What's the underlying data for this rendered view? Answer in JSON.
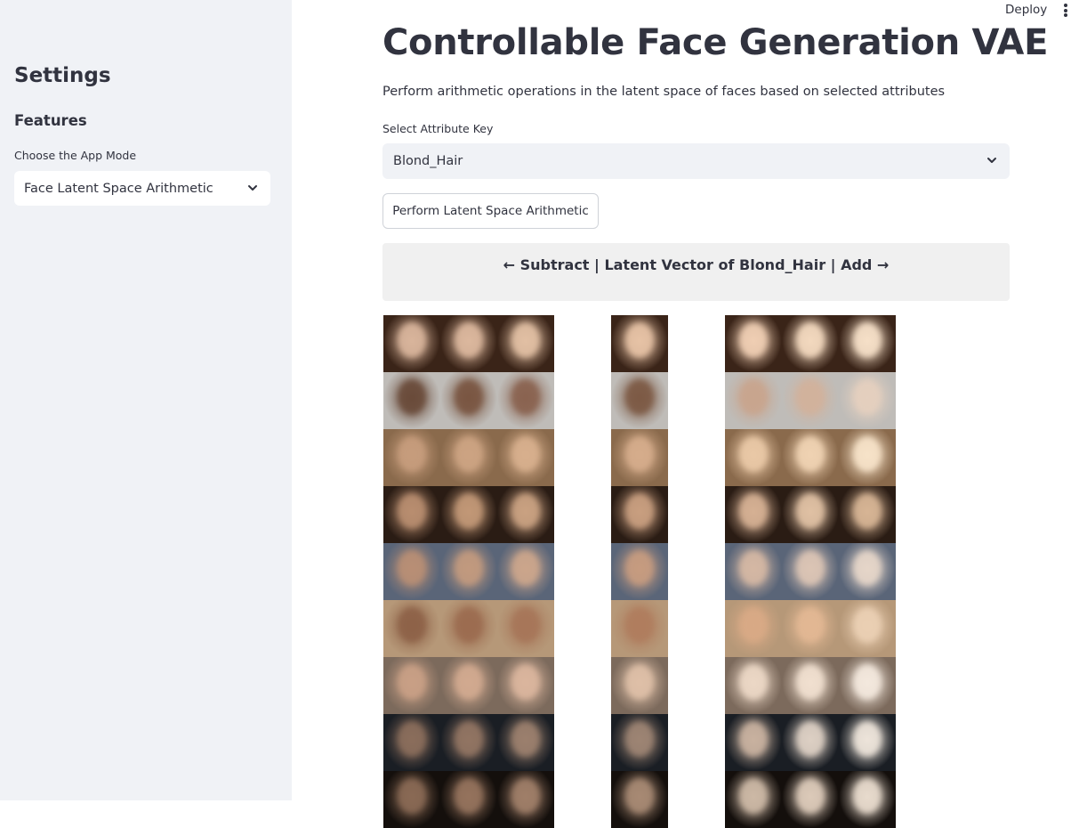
{
  "sidebar": {
    "title": "Settings",
    "subtitle": "Features",
    "mode_label": "Choose the App Mode",
    "mode_value": "Face Latent Space Arithmetic"
  },
  "header": {
    "deploy_label": "Deploy"
  },
  "main": {
    "title": "Controllable Face Generation VAE",
    "description": "Perform arithmetic operations in the latent space of faces based on selected attributes",
    "attribute_label": "Select Attribute Key",
    "attribute_value": "Blond_Hair",
    "button_label": "Perform Latent Space Arithmetic",
    "banner_text": "← Subtract | Latent Vector of Blond_Hair | Add →"
  },
  "face_grids": {
    "rows": [
      {
        "bg": "#3a2418",
        "skin": [
          "#d9b59c",
          "#dcb89e",
          "#e2c0a4",
          "#e7c3a6",
          "#f0cfb4",
          "#f3d9bf",
          "#f6e0c8"
        ]
      },
      {
        "bg": "#bfbcb8",
        "skin": [
          "#6a4b3a",
          "#7a5642",
          "#8a6350",
          "#7d5a45",
          "#c9a58e",
          "#d2b29c",
          "#e5d0bf"
        ]
      },
      {
        "bg": "#8a6a4c",
        "skin": [
          "#c79d7d",
          "#cda483",
          "#d8b08e",
          "#d6ad8c",
          "#eac9a7",
          "#f0d3b3",
          "#f7e3c9"
        ]
      },
      {
        "bg": "#2a1c14",
        "skin": [
          "#b98e70",
          "#c29877",
          "#caa282",
          "#c99f80",
          "#d6b194",
          "#e0c1a4",
          "#d7b595"
        ]
      },
      {
        "bg": "#5a6578",
        "skin": [
          "#b98f75",
          "#c29a7f",
          "#cca68c",
          "#c79c80",
          "#d5b8a4",
          "#dcc5b5",
          "#e6d6c9"
        ]
      },
      {
        "bg": "#b69878",
        "skin": [
          "#8e6248",
          "#9c6c50",
          "#a77659",
          "#b07d5e",
          "#d9aa86",
          "#e3b894",
          "#ebd0b4"
        ]
      },
      {
        "bg": "#7c6a5c",
        "skin": [
          "#c9a086",
          "#d2aa90",
          "#dbb69e",
          "#dfc0a8",
          "#ecd8c6",
          "#f1e0d0",
          "#f4e9de"
        ]
      },
      {
        "bg": "#1a1e24",
        "skin": [
          "#8b6e5c",
          "#927563",
          "#9c806e",
          "#9e8574",
          "#c9b2a0",
          "#ddd0c4",
          "#ede4da"
        ]
      },
      {
        "bg": "#140f0c",
        "skin": [
          "#8a6a55",
          "#95735d",
          "#a07f69",
          "#a88a74",
          "#cdb9a6",
          "#dccab9",
          "#e8dbcd"
        ]
      }
    ]
  },
  "colors": {
    "sidebar_bg": "#f0f2f6",
    "text": "#31333f",
    "banner_bg": "#f0f0f0"
  },
  "icons": [
    "chevron-down-icon",
    "more-vertical-icon"
  ]
}
